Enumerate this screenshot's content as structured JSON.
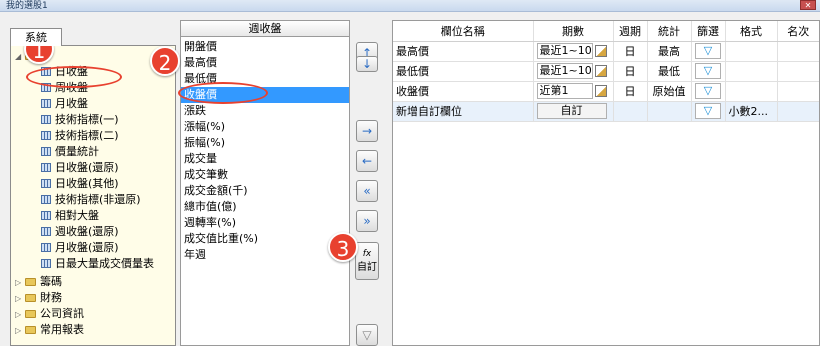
{
  "window": {
    "title": "我的選股1",
    "close": "✕"
  },
  "left": {
    "tab": "系統",
    "tree": [
      {
        "label": "日收盤",
        "type": "item"
      },
      {
        "label": "周收盤",
        "type": "item"
      },
      {
        "label": "月收盤",
        "type": "item"
      },
      {
        "label": "技術指標(一)",
        "type": "item"
      },
      {
        "label": "技術指標(二)",
        "type": "item"
      },
      {
        "label": "價量統計",
        "type": "item"
      },
      {
        "label": "日收盤(還原)",
        "type": "item"
      },
      {
        "label": "日收盤(其他)",
        "type": "item"
      },
      {
        "label": "技術指標(非還原)",
        "type": "item"
      },
      {
        "label": "相對大盤",
        "type": "item"
      },
      {
        "label": "週收盤(還原)",
        "type": "item"
      },
      {
        "label": "月收盤(還原)",
        "type": "item"
      },
      {
        "label": "日最大量成交價量表",
        "type": "item"
      },
      {
        "label": "籌碼",
        "type": "folder"
      },
      {
        "label": "財務",
        "type": "folder"
      },
      {
        "label": "公司資訊",
        "type": "folder"
      },
      {
        "label": "常用報表",
        "type": "folder"
      }
    ]
  },
  "middle": {
    "header": "週收盤",
    "items": [
      "開盤價",
      "最高價",
      "最低價",
      "收盤價",
      "漲跌",
      "漲幅(%)",
      "振幅(%)",
      "成交量",
      "成交筆數",
      "成交金額(千)",
      "總市值(億)",
      "週轉率(%)",
      "成交值比重(%)",
      "年週"
    ],
    "selected_index": 3
  },
  "buttons": {
    "up": "↑",
    "down": "↓",
    "add": "→",
    "remove": "←",
    "remove_all": "«",
    "add_all": "»",
    "custom_icon": "fx",
    "custom_label": "自訂",
    "filter_icon": "▽"
  },
  "grid": {
    "headers": [
      "欄位名稱",
      "期數",
      "週期",
      "統計",
      "篩選",
      "格式",
      "名次"
    ],
    "rows": [
      {
        "name": "最高價",
        "period": "最近1~10",
        "cycle": "日",
        "stat": "最高",
        "format": ""
      },
      {
        "name": "最低價",
        "period": "最近1~10",
        "cycle": "日",
        "stat": "最低",
        "format": ""
      },
      {
        "name": "收盤價",
        "period": "近第1",
        "cycle": "日",
        "stat": "原始值",
        "format": ""
      }
    ],
    "new_row": {
      "name": "新增自訂欄位",
      "button": "自訂",
      "format": "小數2..."
    },
    "filter_icon": "▽"
  },
  "annotations": [
    "1",
    "2",
    "3"
  ],
  "colors": {
    "selection": "#3399ff",
    "annotation": "#e8412f",
    "tree_bg": "#fffde8"
  }
}
